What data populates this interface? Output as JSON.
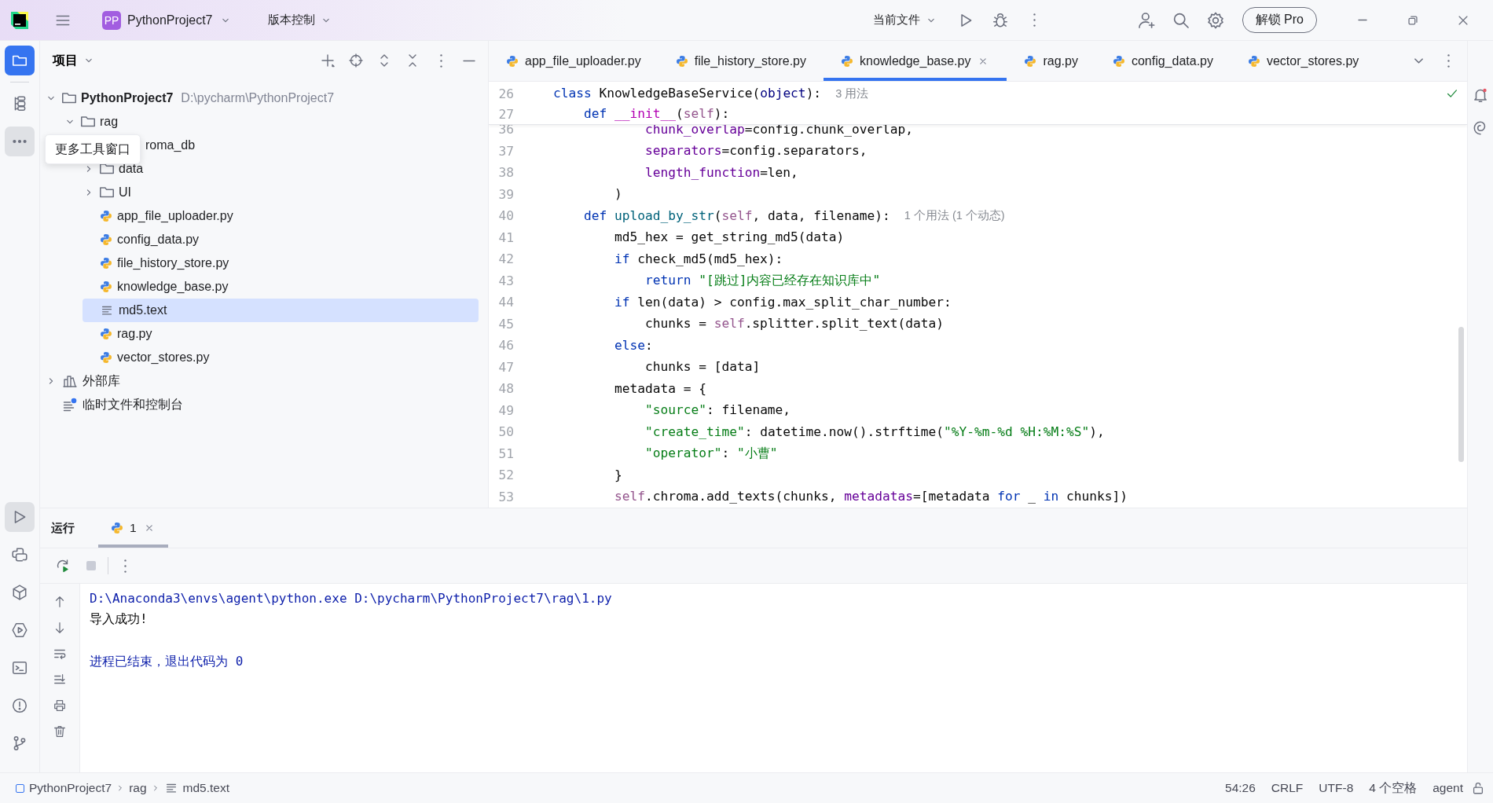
{
  "top_bar": {
    "project": {
      "badge": "PP",
      "name": "PythonProject7"
    },
    "vcs": "版本控制",
    "run_config": "当前文件",
    "unlock_button": "解锁 Pro"
  },
  "left_tools": {
    "top": [
      {
        "selected": true,
        "highlighted": false
      },
      {
        "selected": false,
        "highlighted": false
      },
      {
        "selected": false,
        "highlighted": true
      }
    ],
    "bottom": [
      {
        "selected": false,
        "highlighted": true
      },
      {
        "selected": false,
        "highlighted": false
      },
      {
        "selected": false,
        "highlighted": false
      },
      {
        "selected": false,
        "highlighted": false
      },
      {
        "selected": false,
        "highlighted": false
      },
      {
        "selected": false,
        "highlighted": false
      },
      {
        "selected": false,
        "highlighted": false
      }
    ]
  },
  "tooltip": "更多工具窗口",
  "project_panel": {
    "title": "项目",
    "tree": [
      {
        "kind": "folder",
        "name": "PythonProject7",
        "path": "D:\\pycharm\\PythonProject7",
        "expanded": true,
        "selected": false,
        "children": [
          {
            "kind": "folder",
            "name": "rag",
            "expanded": true,
            "selected": false,
            "children": [
              {
                "kind": "covered",
                "name": "roma_db",
                "selected": false
              },
              {
                "kind": "folder",
                "name": "data",
                "expanded": false,
                "selected": false
              },
              {
                "kind": "folder",
                "name": "UI",
                "expanded": false,
                "selected": false
              },
              {
                "kind": "python",
                "name": "app_file_uploader.py",
                "selected": false
              },
              {
                "kind": "python",
                "name": "config_data.py",
                "selected": false
              },
              {
                "kind": "python",
                "name": "file_history_store.py",
                "selected": false
              },
              {
                "kind": "python",
                "name": "knowledge_base.py",
                "selected": false
              },
              {
                "kind": "text",
                "name": "md5.text",
                "selected": true
              },
              {
                "kind": "python",
                "name": "rag.py",
                "selected": false
              },
              {
                "kind": "python",
                "name": "vector_stores.py",
                "selected": false
              }
            ]
          }
        ]
      },
      {
        "kind": "library",
        "name": "外部库",
        "expanded": false,
        "selected": false
      },
      {
        "kind": "scratch",
        "name": "临时文件和控制台",
        "selected": false
      }
    ]
  },
  "editor": {
    "tabs": [
      {
        "label": "app_file_uploader.py",
        "selected": false
      },
      {
        "label": "file_history_store.py",
        "selected": false
      },
      {
        "label": "knowledge_base.py",
        "selected": true
      },
      {
        "label": "rag.py",
        "selected": false
      },
      {
        "label": "config_data.py",
        "selected": false
      },
      {
        "label": "vector_stores.py",
        "selected": false
      }
    ],
    "sticky_lines": [
      {
        "number": "26",
        "tokens": [
          {
            "kind": "kw",
            "text": "class"
          },
          {
            "kind": "plain",
            "text": " KnowledgeBaseService("
          },
          {
            "kind": "builtin",
            "text": "object"
          },
          {
            "kind": "plain",
            "text": "):"
          },
          {
            "kind": "hint",
            "text": "3 用法"
          }
        ]
      },
      {
        "number": "27",
        "tokens": [
          {
            "kind": "kw",
            "text": "    def"
          },
          {
            "kind": "magic",
            "text": " __init__"
          },
          {
            "kind": "plain",
            "text": "("
          },
          {
            "kind": "self",
            "text": "self"
          },
          {
            "kind": "plain",
            "text": "):"
          }
        ]
      }
    ],
    "lines": [
      {
        "number": "36",
        "tokens": [
          {
            "kind": "kwarg",
            "text": "            chunk_overlap"
          },
          {
            "kind": "plain",
            "text": "=config.chunk_overlap,"
          }
        ]
      },
      {
        "number": "37",
        "tokens": [
          {
            "kind": "kwarg",
            "text": "            separators"
          },
          {
            "kind": "plain",
            "text": "=config.separators,"
          }
        ]
      },
      {
        "number": "38",
        "tokens": [
          {
            "kind": "kwarg",
            "text": "            length_function"
          },
          {
            "kind": "plain",
            "text": "=len,"
          }
        ]
      },
      {
        "number": "39",
        "tokens": [
          {
            "kind": "plain",
            "text": "        )"
          }
        ]
      },
      {
        "number": "40",
        "tokens": [
          {
            "kind": "kw",
            "text": "    def"
          },
          {
            "kind": "fn",
            "text": " upload_by_str"
          },
          {
            "kind": "plain",
            "text": "("
          },
          {
            "kind": "self",
            "text": "self"
          },
          {
            "kind": "plain",
            "text": ", data, filename):"
          },
          {
            "kind": "hint",
            "text": "1 个用法 (1 个动态)"
          }
        ]
      },
      {
        "number": "41",
        "tokens": [
          {
            "kind": "plain",
            "text": "        md5_hex = get_string_md5(data)"
          }
        ]
      },
      {
        "number": "42",
        "tokens": [
          {
            "kind": "kw",
            "text": "        if"
          },
          {
            "kind": "plain",
            "text": " check_md5(md5_hex):"
          }
        ]
      },
      {
        "number": "43",
        "tokens": [
          {
            "kind": "kw",
            "text": "            return"
          },
          {
            "kind": "str",
            "text": " \"[跳过]内容已经存在知识库中\""
          }
        ]
      },
      {
        "number": "44",
        "tokens": [
          {
            "kind": "kw",
            "text": "        if"
          },
          {
            "kind": "plain",
            "text": " len(data) > config.max_split_char_number:"
          }
        ]
      },
      {
        "number": "45",
        "tokens": [
          {
            "kind": "plain",
            "text": "            chunks = "
          },
          {
            "kind": "self",
            "text": "self"
          },
          {
            "kind": "plain",
            "text": ".splitter.split_text(data)"
          }
        ]
      },
      {
        "number": "46",
        "tokens": [
          {
            "kind": "kw",
            "text": "        else"
          },
          {
            "kind": "plain",
            "text": ":"
          }
        ]
      },
      {
        "number": "47",
        "tokens": [
          {
            "kind": "plain",
            "text": "            chunks = [data]"
          }
        ]
      },
      {
        "number": "48",
        "tokens": [
          {
            "kind": "plain",
            "text": "        metadata = {"
          }
        ]
      },
      {
        "number": "49",
        "tokens": [
          {
            "kind": "str",
            "text": "            \"source\""
          },
          {
            "kind": "plain",
            "text": ": filename,"
          }
        ]
      },
      {
        "number": "50",
        "tokens": [
          {
            "kind": "str",
            "text": "            \"create_time\""
          },
          {
            "kind": "plain",
            "text": ": datetime.now().strftime("
          },
          {
            "kind": "str",
            "text": "\"%Y-%m-%d %H:%M:%S\""
          },
          {
            "kind": "plain",
            "text": "),"
          }
        ]
      },
      {
        "number": "51",
        "tokens": [
          {
            "kind": "str",
            "text": "            \"operator\""
          },
          {
            "kind": "plain",
            "text": ": "
          },
          {
            "kind": "str",
            "text": "\"小曹\""
          }
        ]
      },
      {
        "number": "52",
        "tokens": [
          {
            "kind": "plain",
            "text": "        }"
          }
        ]
      },
      {
        "number": "53",
        "tokens": [
          {
            "kind": "self",
            "text": "        self"
          },
          {
            "kind": "plain",
            "text": ".chroma.add_texts(chunks, "
          },
          {
            "kind": "kwarg",
            "text": "metadatas"
          },
          {
            "kind": "plain",
            "text": "=[metadata "
          },
          {
            "kind": "kw",
            "text": "for"
          },
          {
            "kind": "plain",
            "text": " _ "
          },
          {
            "kind": "kw",
            "text": "in"
          },
          {
            "kind": "plain",
            "text": " chunks])"
          }
        ]
      }
    ]
  },
  "run_panel": {
    "title": "运行",
    "tabs": [
      {
        "label": "1",
        "selected": true
      }
    ],
    "console": [
      {
        "kind": "command",
        "text": "D:\\Anaconda3\\envs\\agent\\python.exe D:\\pycharm\\PythonProject7\\rag\\1.py"
      },
      {
        "kind": "output",
        "text": "导入成功!"
      },
      {
        "kind": "blank"
      },
      {
        "kind": "exit",
        "text": "进程已结束，退出代码为 0"
      }
    ]
  },
  "status_bar": {
    "breadcrumbs": [
      {
        "kind": "project",
        "label": "PythonProject7"
      },
      {
        "kind": "folder",
        "label": "rag"
      },
      {
        "kind": "text",
        "label": "md5.text"
      }
    ],
    "items": [
      "54:26",
      "CRLF",
      "UTF-8",
      "4 个空格",
      "agent"
    ]
  }
}
